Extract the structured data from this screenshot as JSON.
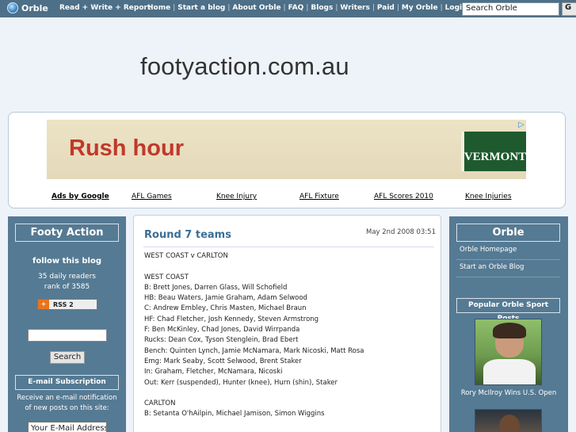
{
  "topbar": {
    "logo_text": "Orble",
    "tagline": "Read + Write + Report",
    "nav": [
      "Home",
      "Start a blog",
      "About Orble",
      "FAQ",
      "Blogs",
      "Writers",
      "Paid",
      "My Orble",
      "Login"
    ],
    "search_value": "Search Orble",
    "go_label": "G"
  },
  "site": {
    "title": "footyaction.com.au"
  },
  "ad": {
    "headline": "Rush hour",
    "brand": "VERMONT",
    "choices_glyph": "▷",
    "links": [
      "Ads by Google",
      "AFL Games",
      "Knee Injury",
      "AFL Fixture",
      "AFL Scores 2010",
      "Knee Injuries"
    ]
  },
  "left": {
    "title": "Footy Action",
    "follow": "follow this blog",
    "readers": "35 daily readers",
    "rank": "rank of 3585",
    "rss_label": "RSS 2",
    "rss_glyph": "+",
    "search_label": "Search",
    "email_title": "E-mail Subscription",
    "email_desc": "Receive an e-mail notification of new posts on this site:",
    "email_value": "Your E-Mail Address"
  },
  "post": {
    "title": "Round 7 teams",
    "date": "May 2nd 2008 03:51",
    "lines": [
      "WEST COAST v CARLTON",
      "",
      "WEST COAST",
      "B: Brett Jones, Darren Glass, Will Schofield",
      "HB: Beau Waters, Jamie Graham, Adam Selwood",
      "C: Andrew Embley, Chris Masten, Michael Braun",
      "HF: Chad Fletcher, Josh Kennedy, Steven Armstrong",
      "F: Ben McKinley, Chad Jones, David Wirrpanda",
      "Rucks: Dean Cox, Tyson Stenglein, Brad Ebert",
      "Bench: Quinten Lynch, Jamie McNamara, Mark Nicoski, Matt Rosa",
      "Emg: Mark Seaby, Scott Selwood, Brent Staker",
      "In: Graham, Fletcher, McNamara, Nicoski",
      "Out: Kerr (suspended), Hunter (knee), Hurn (shin), Staker",
      "",
      "CARLTON",
      "B: Setanta O'hAilpin, Michael Jamison, Simon Wiggins"
    ]
  },
  "right": {
    "title": "Orble",
    "links": [
      "Orble Homepage",
      "Start an Orble Blog"
    ],
    "popular_title": "Popular Orble Sport Posts",
    "caption": "Rory McIlroy Wins U.S. Open"
  }
}
